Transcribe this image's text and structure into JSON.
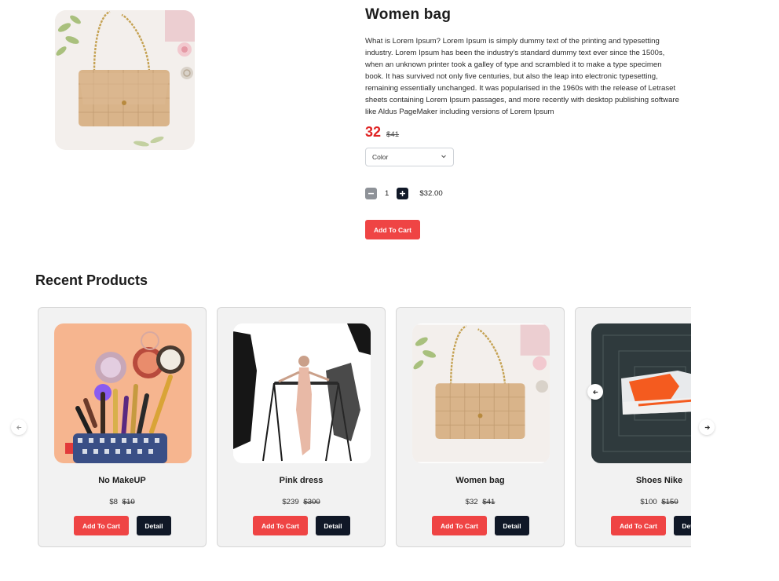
{
  "product": {
    "title": "Women bag",
    "description": "What is Lorem Ipsum? Lorem Ipsum is simply dummy text of the printing and typesetting industry. Lorem Ipsum has been the industry's standard dummy text ever since the 1500s, when an unknown printer took a galley of type and scrambled it to make a type specimen book. It has survived not only five centuries, but also the leap into electronic typesetting, remaining essentially unchanged. It was popularised in the 1960s with the release of Letraset sheets containing Lorem Ipsum passages, and more recently with desktop publishing software like Aldus PageMaker including versions of Lorem Ipsum",
    "price": "32",
    "old_price": "$41",
    "color_select": "Color",
    "quantity": "1",
    "total": "$32.00",
    "add_to_cart": "Add To Cart",
    "image_icon": "handbag-image"
  },
  "recent": {
    "title": "Recent Products",
    "items": [
      {
        "name": "No MakeUP",
        "price": "$8",
        "old_price": "$10",
        "cart_label": "Add To Cart",
        "detail_label": "Detail",
        "image": "makeup-image"
      },
      {
        "name": "Pink dress",
        "price": "$239",
        "old_price": "$300",
        "cart_label": "Add To Cart",
        "detail_label": "Detail",
        "image": "dress-image"
      },
      {
        "name": "Women bag",
        "price": "$32",
        "old_price": "$41",
        "cart_label": "Add To Cart",
        "detail_label": "Detail",
        "image": "handbag-image"
      },
      {
        "name": "Shoes Nike",
        "price": "$100",
        "old_price": "$150",
        "cart_label": "Add To Cart",
        "detail_label": "Detail",
        "image": "sneaker-image"
      }
    ]
  },
  "colors": {
    "accent": "#ef4444",
    "price_red": "#e02424",
    "dark_button": "#101827",
    "card_bg": "#f2f2f2"
  }
}
